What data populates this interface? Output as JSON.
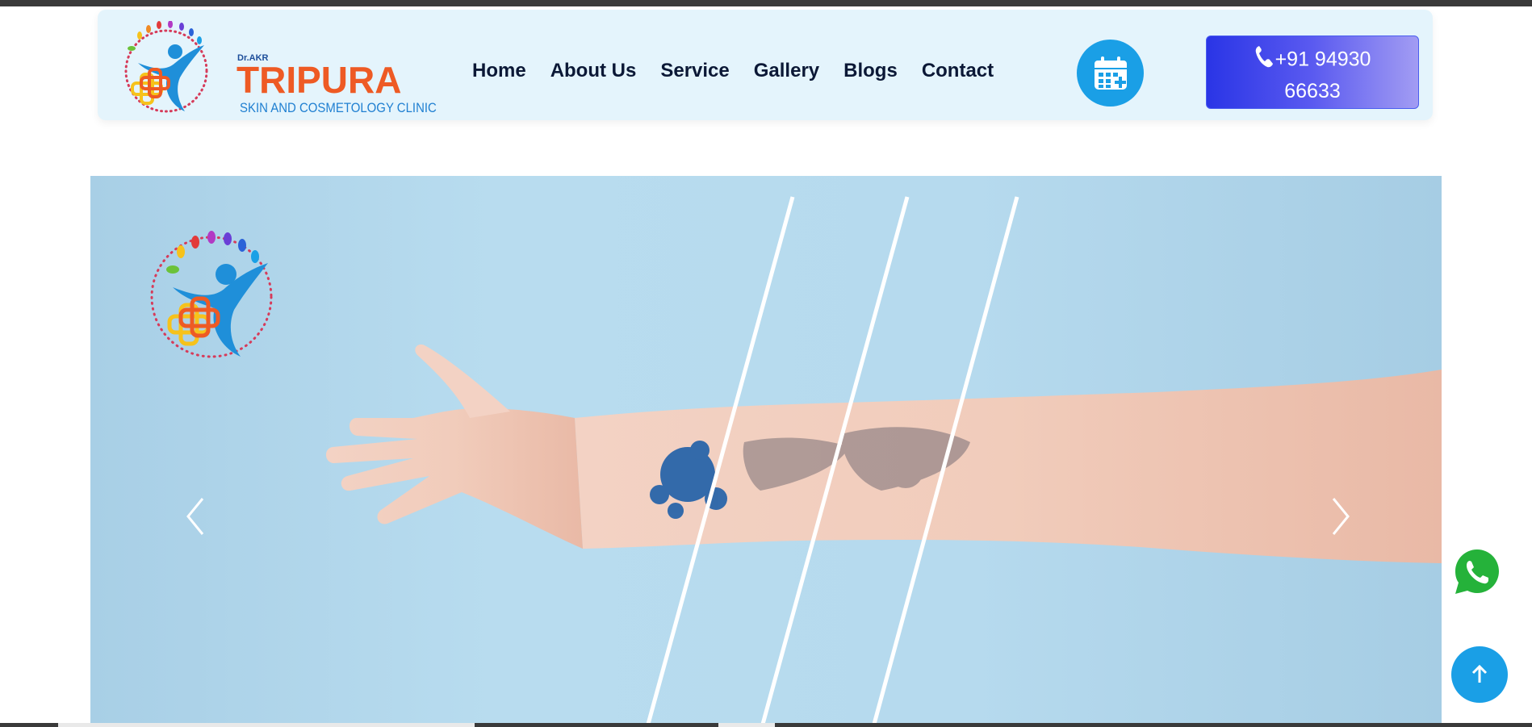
{
  "brand": {
    "prefix": "Dr.AKR",
    "name": "TRIPURA",
    "tagline": "SKIN AND COSMETOLOGY CLINIC"
  },
  "nav": {
    "items": [
      {
        "label": "Home"
      },
      {
        "label": "About Us"
      },
      {
        "label": "Service"
      },
      {
        "label": "Gallery"
      },
      {
        "label": "Blogs"
      },
      {
        "label": "Contact"
      }
    ]
  },
  "header_actions": {
    "calendar_icon": "calendar-plus-icon",
    "phone_icon": "phone-icon",
    "phone_line1": "+91 94930",
    "phone_line2": "66633"
  },
  "hero": {
    "subject": "forearm tattoo removal",
    "prev_icon": "chevron-left-icon",
    "next_icon": "chevron-right-icon"
  },
  "floating": {
    "whatsapp_icon": "whatsapp-icon",
    "scroll_top_icon": "arrow-up-icon"
  },
  "colors": {
    "header_bg": "#e4f4fc",
    "accent_blue": "#1a9fe6",
    "brand_orange": "#ee5a24",
    "phone_gradient_start": "#2a35e6",
    "phone_gradient_end": "#a29cf3",
    "nav_text": "#0b1836",
    "whatsapp_green": "#25b23a"
  }
}
